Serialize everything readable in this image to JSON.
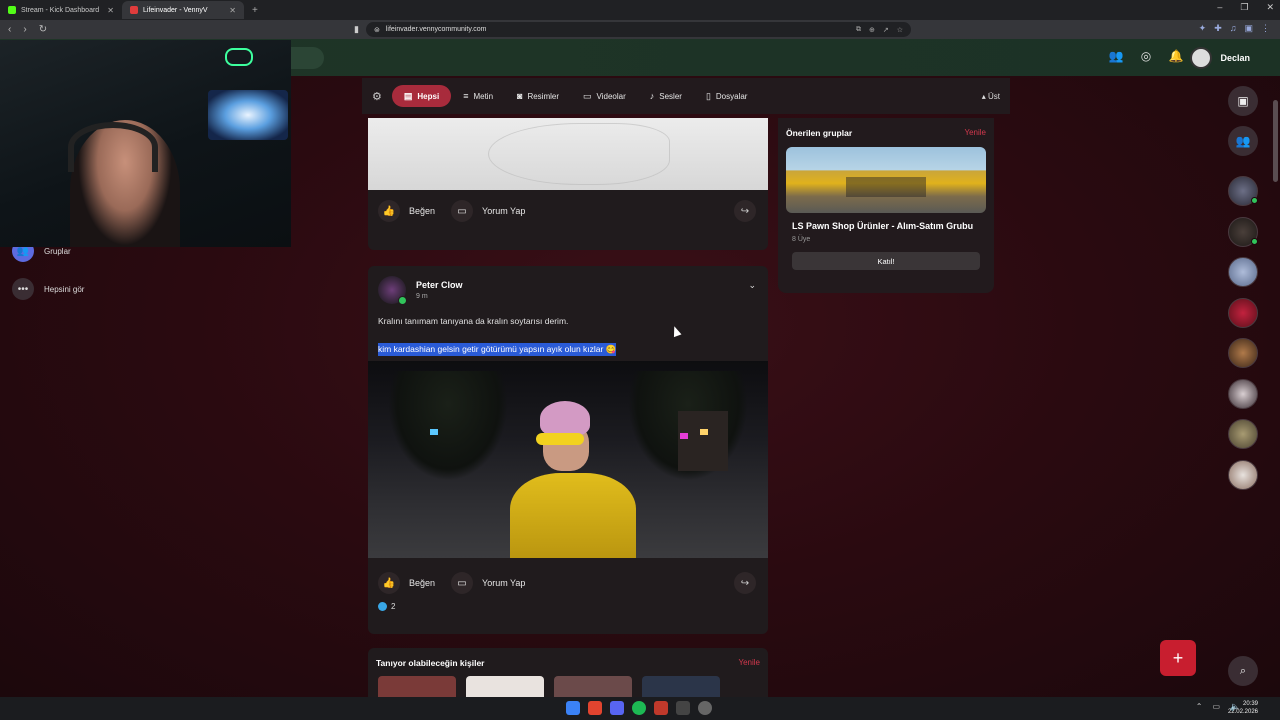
{
  "browser": {
    "tabs": [
      {
        "title": "Stream - Kick Dashboard",
        "favicon_color": "#53fc18",
        "active": false
      },
      {
        "title": "Lifeinvader - VennyV",
        "favicon_color": "#e03c3c",
        "active": true
      }
    ],
    "new_tab": "+",
    "url": "lifeinvader.vennycommunity.com"
  },
  "site_nav": {
    "user_name": "Declan"
  },
  "left_nav": {
    "items": [
      {
        "label": "Gruplar",
        "icon": "groups-icon"
      },
      {
        "label": "Hepsini gör",
        "icon": "more-icon"
      }
    ]
  },
  "filters": {
    "items": [
      {
        "label": "Hepsi",
        "icon": "list-icon",
        "active": true
      },
      {
        "label": "Metin",
        "icon": "text-icon",
        "active": false
      },
      {
        "label": "Resimler",
        "icon": "camera-icon",
        "active": false
      },
      {
        "label": "Videolar",
        "icon": "video-icon",
        "active": false
      },
      {
        "label": "Sesler",
        "icon": "music-icon",
        "active": false
      },
      {
        "label": "Dosyalar",
        "icon": "file-icon",
        "active": false
      }
    ],
    "top_label": "Üst"
  },
  "post1": {
    "like_label": "Beğen",
    "comment_label": "Yorum Yap"
  },
  "post2": {
    "author": "Peter Clow",
    "time": "9 m",
    "text_line1": "Kralını tanımam tanıyana da kralın soytarısı derim.",
    "text_line2": "kim kardashian gelsin getir götürümü yapsın ayık olun kızlar 😋",
    "like_label": "Beğen",
    "comment_label": "Yorum Yap",
    "reaction_count": "2"
  },
  "people_section": {
    "title": "Tanıyor olabileceğin kişiler",
    "refresh_label": "Yenile"
  },
  "suggested_groups": {
    "title": "Önerilen gruplar",
    "refresh_label": "Yenile",
    "group_name": "LS Pawn Shop Ürünler - Alım-Satım Grubu",
    "member_count": "8 Üye",
    "join_label": "Katıl!"
  },
  "clock": {
    "time": "20:39",
    "date": "22.02.2026"
  },
  "colors": {
    "accent": "#a82b3c",
    "refresh": "#d2384d",
    "fab": "#c81e2f",
    "online": "#31c45b"
  }
}
